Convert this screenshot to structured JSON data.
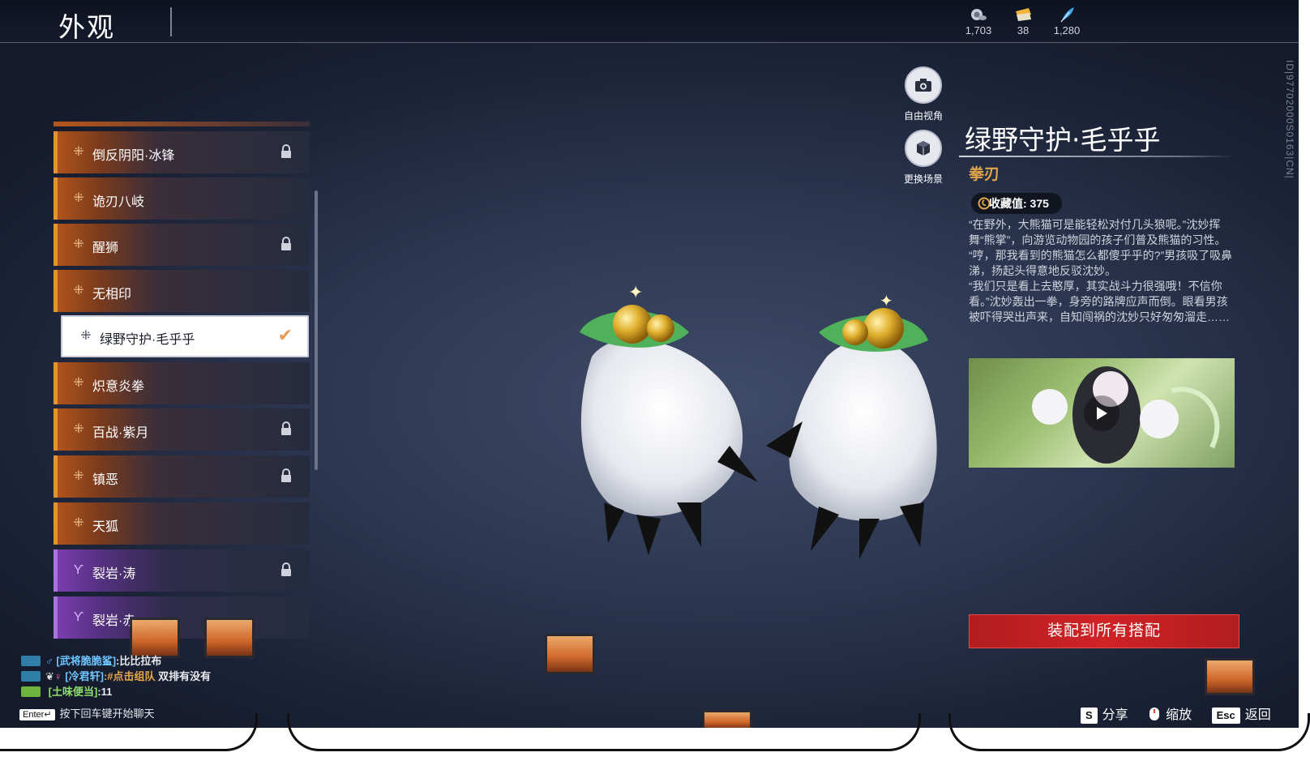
{
  "header": {
    "title": "外观"
  },
  "currencies": [
    {
      "icon": "snail-coin-icon",
      "value": "1,703"
    },
    {
      "icon": "ticket-icon",
      "value": "38"
    },
    {
      "icon": "feather-icon",
      "value": "1,280"
    }
  ],
  "vertical_id": "ID|97702000S0163|CN|",
  "items": [
    {
      "label": "倒反阴阳·冰锋",
      "locked": true,
      "style": "orange"
    },
    {
      "label": "诡刃八岐",
      "locked": false,
      "style": "orange"
    },
    {
      "label": "醒狮",
      "locked": true,
      "style": "orange"
    },
    {
      "label": "无相印",
      "locked": false,
      "style": "orange"
    },
    {
      "label": "绿野守护·毛乎乎",
      "locked": false,
      "style": "orange",
      "selected": true
    },
    {
      "label": "炽意炎拳",
      "locked": false,
      "style": "orange"
    },
    {
      "label": "百战·紫月",
      "locked": true,
      "style": "orange"
    },
    {
      "label": "镇恶",
      "locked": true,
      "style": "orange"
    },
    {
      "label": "天狐",
      "locked": false,
      "style": "orange"
    },
    {
      "label": "裂岩·涛",
      "locked": true,
      "style": "purple"
    },
    {
      "label": "裂岩·赤",
      "locked": false,
      "style": "purple"
    }
  ],
  "side_buttons": {
    "free_view": "自由视角",
    "change_scene": "更换场景"
  },
  "detail": {
    "title": "绿野守护·毛乎乎",
    "type": "拳刃",
    "collect_label": "收藏值: 375",
    "paragraphs": [
      "“在野外，大熊猫可是能轻松对付几头狼呢。”沈妙挥舞“熊掌”，向游览动物园的孩子们普及熊猫的习性。",
      "“哼，那我看到的熊猫怎么都傻乎乎的?”男孩吸了吸鼻涕，扬起头得意地反驳沈妙。",
      "“我们只是看上去憨厚，其实战斗力很强哦！不信你看。”沈妙轰出一拳，身旁的路牌应声而倒。眼看男孩被吓得哭出声来，自知闯祸的沈妙只好匆匆溜走……"
    ],
    "equip_all": "装配到所有搭配"
  },
  "chat": {
    "lines": [
      {
        "name": "[武将脆脆鲨]",
        "text": ":比比拉布"
      },
      {
        "name": "[冷君轩]",
        "tag": ":#点击组队",
        "text": " 双排有没有"
      },
      {
        "name": "[土味便当]",
        "text": ":11"
      }
    ],
    "enter_key": "Enter↵",
    "hint": "按下回车键开始聊天"
  },
  "hotkeys": [
    {
      "key": "S",
      "label": "分享"
    },
    {
      "key": "",
      "label": "缩放"
    },
    {
      "key": "Esc",
      "label": "返回"
    }
  ]
}
